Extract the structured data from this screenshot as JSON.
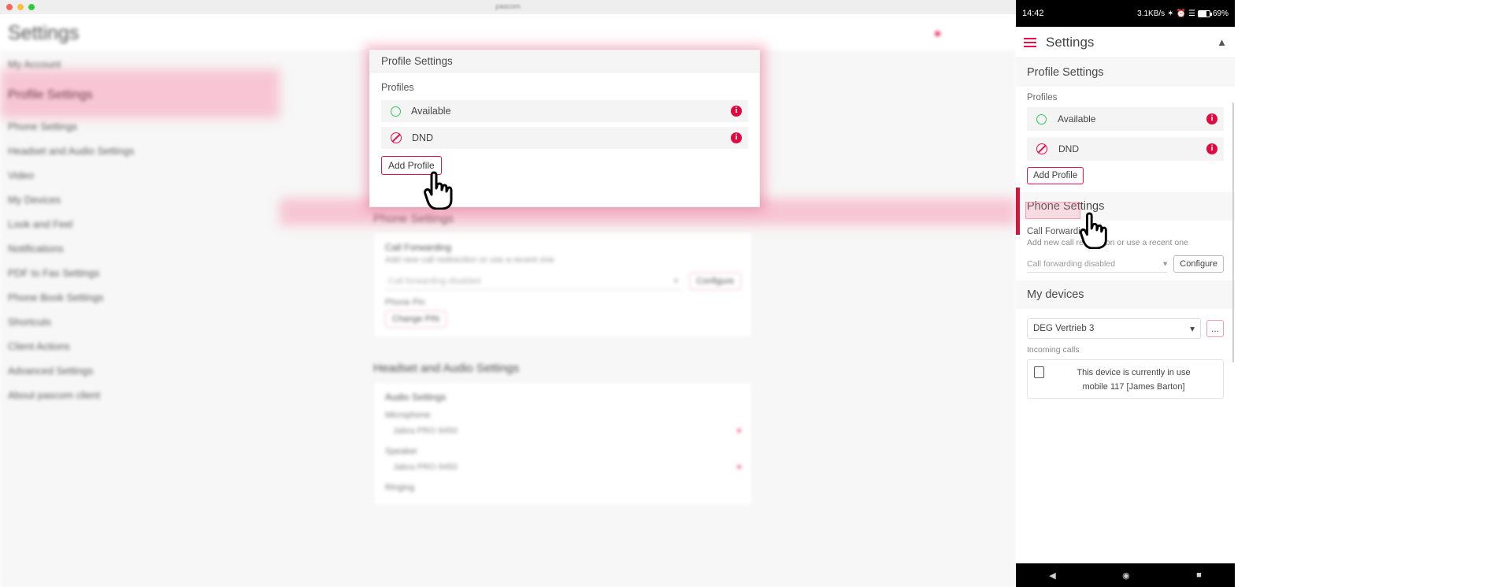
{
  "window": {
    "title": "pascom",
    "traffic_lights": [
      "close-red",
      "minimize-yellow",
      "zoom-green"
    ]
  },
  "desktop": {
    "header": {
      "title": "Settings",
      "bell_icon": "bell-icon"
    },
    "sidebar": {
      "items": [
        {
          "label": "My Account",
          "selected": false
        },
        {
          "label": "Profile Settings",
          "selected": true
        },
        {
          "label": "Phone Settings",
          "selected": false
        },
        {
          "label": "Headset and Audio Settings",
          "selected": false
        },
        {
          "label": "Video",
          "selected": false
        },
        {
          "label": "My Devices",
          "selected": false
        },
        {
          "label": "Look and Feel",
          "selected": false
        },
        {
          "label": "Notifications",
          "selected": false
        },
        {
          "label": "PDF to Fax Settings",
          "selected": false
        },
        {
          "label": "Phone Book Settings",
          "selected": false
        },
        {
          "label": "Shortcuts",
          "selected": false
        },
        {
          "label": "Client Actions",
          "selected": false
        },
        {
          "label": "Advanced Settings",
          "selected": false
        },
        {
          "label": "About pascom client",
          "selected": false
        }
      ]
    },
    "phone_settings": {
      "section_title": "Phone Settings",
      "call_forwarding_label": "Call Forwarding",
      "call_forwarding_sub": "Add new call redirection or use a recent one",
      "call_forwarding_value": "Call forwarding disabled",
      "configure_label": "Configure",
      "phone_pin_label": "Phone Pin",
      "change_pin_label": "Change PIN"
    },
    "headset_settings": {
      "section_title": "Headset and Audio Settings",
      "card_title": "Audio Settings",
      "microphone_label": "Microphone",
      "microphone_value": "Jabra PRO 9450",
      "speaker_label": "Speaker",
      "speaker_value": "Jabra PRO 9450",
      "ringing_label": "Ringing"
    },
    "modal": {
      "title": "Profile Settings",
      "profiles_label": "Profiles",
      "profiles": [
        {
          "name": "Available",
          "status_icon": "available-circle-icon",
          "info_icon": "info-icon",
          "info_text": "i"
        },
        {
          "name": "DND",
          "status_icon": "do-not-disturb-icon",
          "info_icon": "info-icon",
          "info_text": "i"
        }
      ],
      "add_profile_label": "Add Profile"
    },
    "cursor": {
      "icon": "pointing-hand-cursor"
    }
  },
  "mobile": {
    "status_bar": {
      "time": "14:42",
      "network_speed": "3.1KB/s",
      "bluetooth_icon": "bluetooth-icon",
      "alarm_icon": "alarm-icon",
      "signal_icon": "signal-bars-icon",
      "battery_icon": "battery-icon",
      "battery_level": "69%"
    },
    "header": {
      "menu_icon": "hamburger-menu-icon",
      "title": "Settings",
      "collapse_icon": "chevron-up-icon"
    },
    "profile_section": {
      "section_title": "Profile Settings",
      "profiles_label": "Profiles",
      "profiles": [
        {
          "name": "Available",
          "status_icon": "available-circle-icon",
          "info_icon": "info-icon",
          "info_text": "i"
        },
        {
          "name": "DND",
          "status_icon": "do-not-disturb-icon",
          "info_icon": "info-icon",
          "info_text": "i"
        }
      ],
      "add_profile_label": "Add Profile"
    },
    "phone_section": {
      "section_title": "Phone Settings",
      "call_forwarding_label": "Call Forwarding",
      "call_forwarding_sub": "Add new call redirection or use a recent one",
      "call_forwarding_value": "Call forwarding disabled",
      "configure_label": "Configure"
    },
    "devices_section": {
      "section_title": "My devices",
      "device_value": "DEG Vertrieb 3",
      "more_label": "...",
      "incoming_calls_label": "Incoming calls",
      "in_use_line1": "This device is currently in use",
      "in_use_line2": "mobile 117 [James Barton]",
      "device_icon": "phone-device-icon"
    },
    "navbar": {
      "back_icon": "◀",
      "home_icon": "◉",
      "recents_icon": "■"
    },
    "cursor": {
      "icon": "pointing-hand-cursor"
    }
  },
  "colors": {
    "accent": "#e8104a",
    "info_badge": "#e10a3f",
    "available_green": "#2ecc59",
    "highlight_pink": "#f77ba0",
    "panel_bg": "#f7f7f7"
  }
}
